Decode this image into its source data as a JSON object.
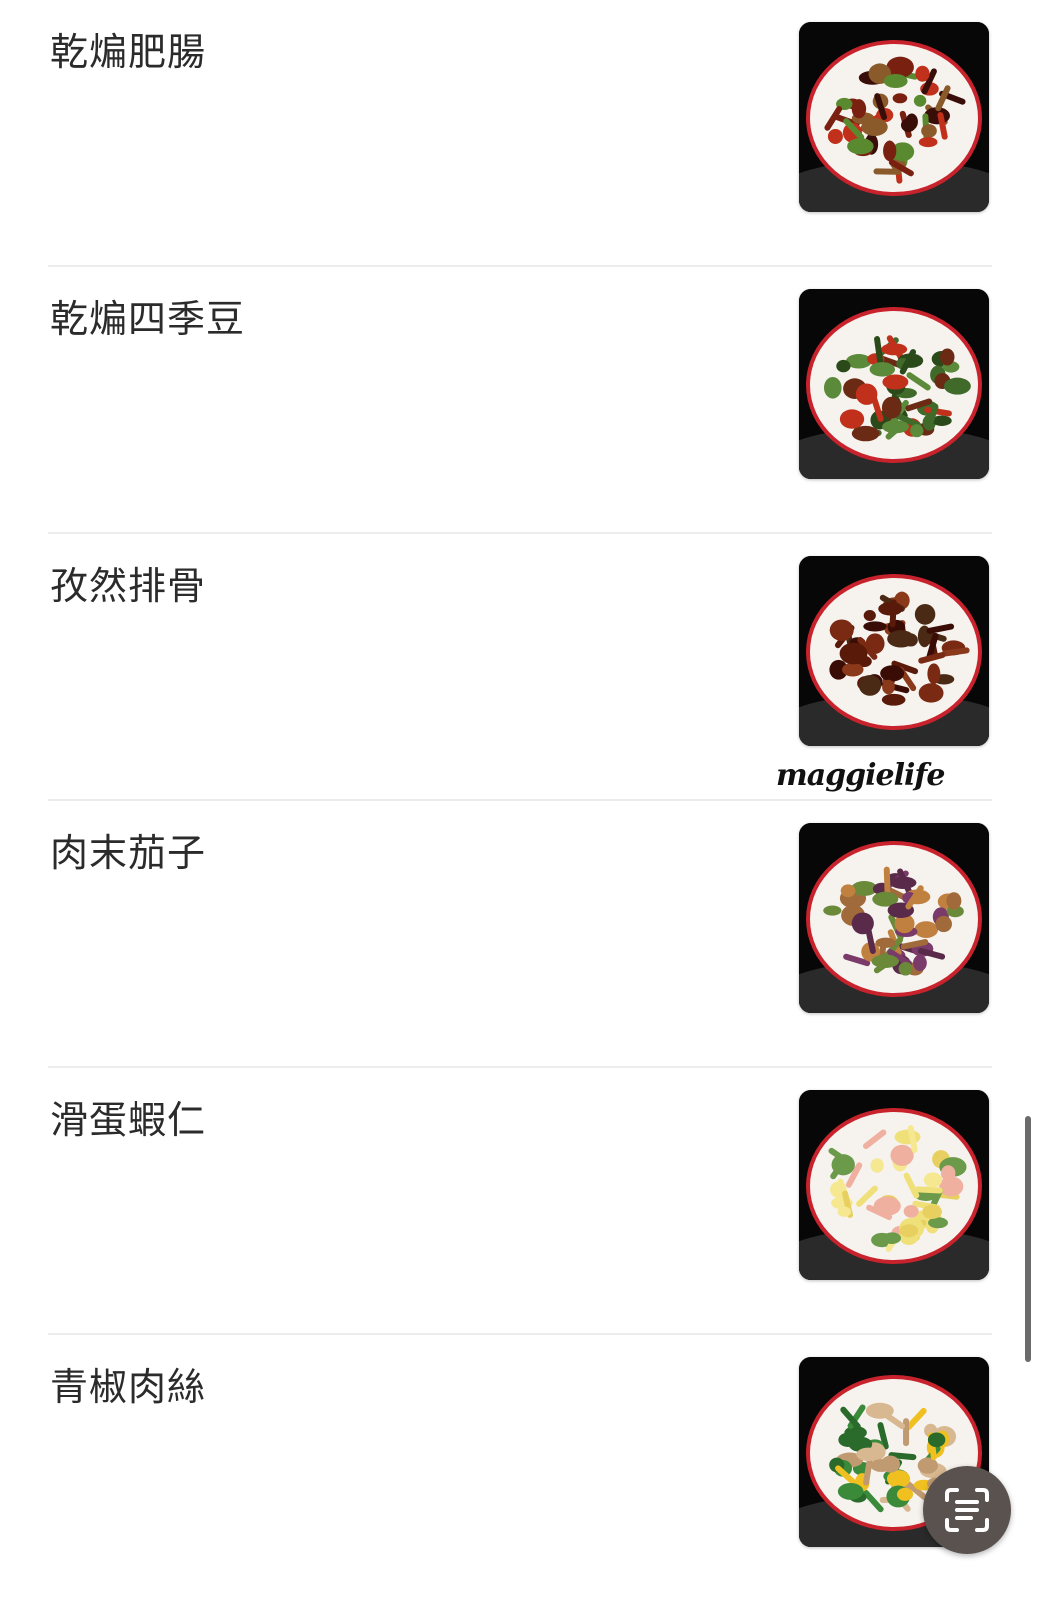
{
  "menu": {
    "items": [
      {
        "name": "乾煸肥腸",
        "photo": "dry-fried-intestines-photo",
        "food_colors": [
          "#7a2010",
          "#3a0e08",
          "#c0301a",
          "#5a8a30",
          "#8a5a2a"
        ]
      },
      {
        "name": "乾煸四季豆",
        "photo": "dry-fried-green-beans-photo",
        "food_colors": [
          "#3f6a2a",
          "#2a4a1a",
          "#5a8a3a",
          "#6a2a14",
          "#c0301a"
        ]
      },
      {
        "name": "孜然排骨",
        "photo": "cumin-spare-ribs-photo",
        "food_colors": [
          "#5a1a0a",
          "#7a2a12",
          "#3a0c06",
          "#8a3a1a",
          "#4a2a14"
        ]
      },
      {
        "name": "肉末茄子",
        "photo": "minced-pork-eggplant-photo",
        "food_colors": [
          "#5a2a4a",
          "#7a3a6a",
          "#c08040",
          "#6a8a3a",
          "#a06a3a"
        ]
      },
      {
        "name": "滑蛋蝦仁",
        "photo": "scrambled-egg-shrimp-photo",
        "food_colors": [
          "#f0e07a",
          "#e8d060",
          "#f5e890",
          "#f0b0a0",
          "#6a9a4a"
        ]
      },
      {
        "name": "青椒肉絲",
        "photo": "green-pepper-pork-photo",
        "food_colors": [
          "#2a6a2a",
          "#3a8a3a",
          "#d8b890",
          "#c09a70",
          "#f0c020"
        ]
      }
    ]
  },
  "plate_rim_color": "#c8232c",
  "watermark": "maggielife",
  "fab_icon": "scan-text-icon"
}
